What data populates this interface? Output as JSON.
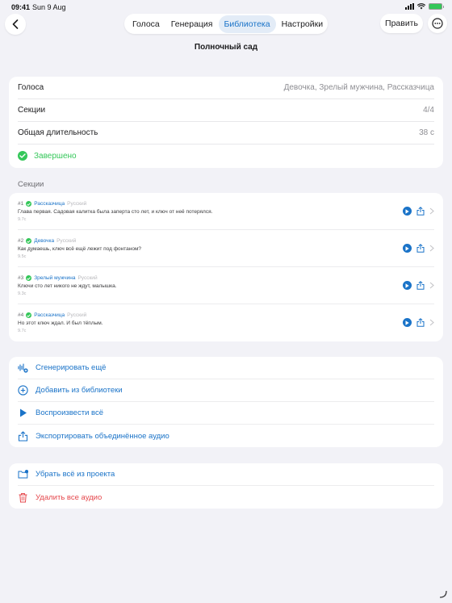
{
  "status_bar": {
    "time": "09:41",
    "date": "Sun 9 Aug"
  },
  "nav": {
    "tabs": [
      {
        "label": "Голоса",
        "active": false
      },
      {
        "label": "Генерация",
        "active": false
      },
      {
        "label": "Библиотека",
        "active": true
      },
      {
        "label": "Настройки",
        "active": false
      }
    ],
    "edit_label": "Править",
    "back_icon": "chevron-left-icon",
    "more_icon": "ellipsis-circle-icon"
  },
  "page": {
    "title": "Полночный сад"
  },
  "info": {
    "voices_label": "Голоса",
    "voices_value": "Девочка, Зрелый мужчина, Рассказчица",
    "sections_label": "Секции",
    "sections_value": "4/4",
    "duration_label": "Общая длительность",
    "duration_value": "38 с",
    "status_label": "Завершено"
  },
  "sections": {
    "header": "Секции",
    "items": [
      {
        "num": "#1",
        "voice": "Рассказчица",
        "lang": "Русский",
        "text": "Глава первая. Садовая калитка была заперта сто лет, и ключ от неё потерялся.",
        "duration": "9.7с"
      },
      {
        "num": "#2",
        "voice": "Девочка",
        "lang": "Русский",
        "text": "Как думаешь, ключ всё ещё лежит под фонтаном?",
        "duration": "9.5с"
      },
      {
        "num": "#3",
        "voice": "Зрелый мужчина",
        "lang": "Русский",
        "text": "Ключи сто лет никого не ждут, малышка.",
        "duration": "9.3с"
      },
      {
        "num": "#4",
        "voice": "Рассказчица",
        "lang": "Русский",
        "text": "Но этот ключ ждал. И был тёплым.",
        "duration": "9.7с"
      }
    ]
  },
  "actions": {
    "generate_more": "Сгенерировать ещё",
    "add_from_library": "Добавить из библиотеки",
    "play_all": "Воспроизвести всё",
    "export_merged": "Экспортировать объединённое аудио"
  },
  "danger": {
    "remove_all": "Убрать всё из проекта",
    "delete_audio": "Удалить все аудио"
  },
  "colors": {
    "accent": "#1a73c8",
    "success": "#34c759",
    "danger": "#e5484d",
    "background": "#f2f2f7"
  }
}
